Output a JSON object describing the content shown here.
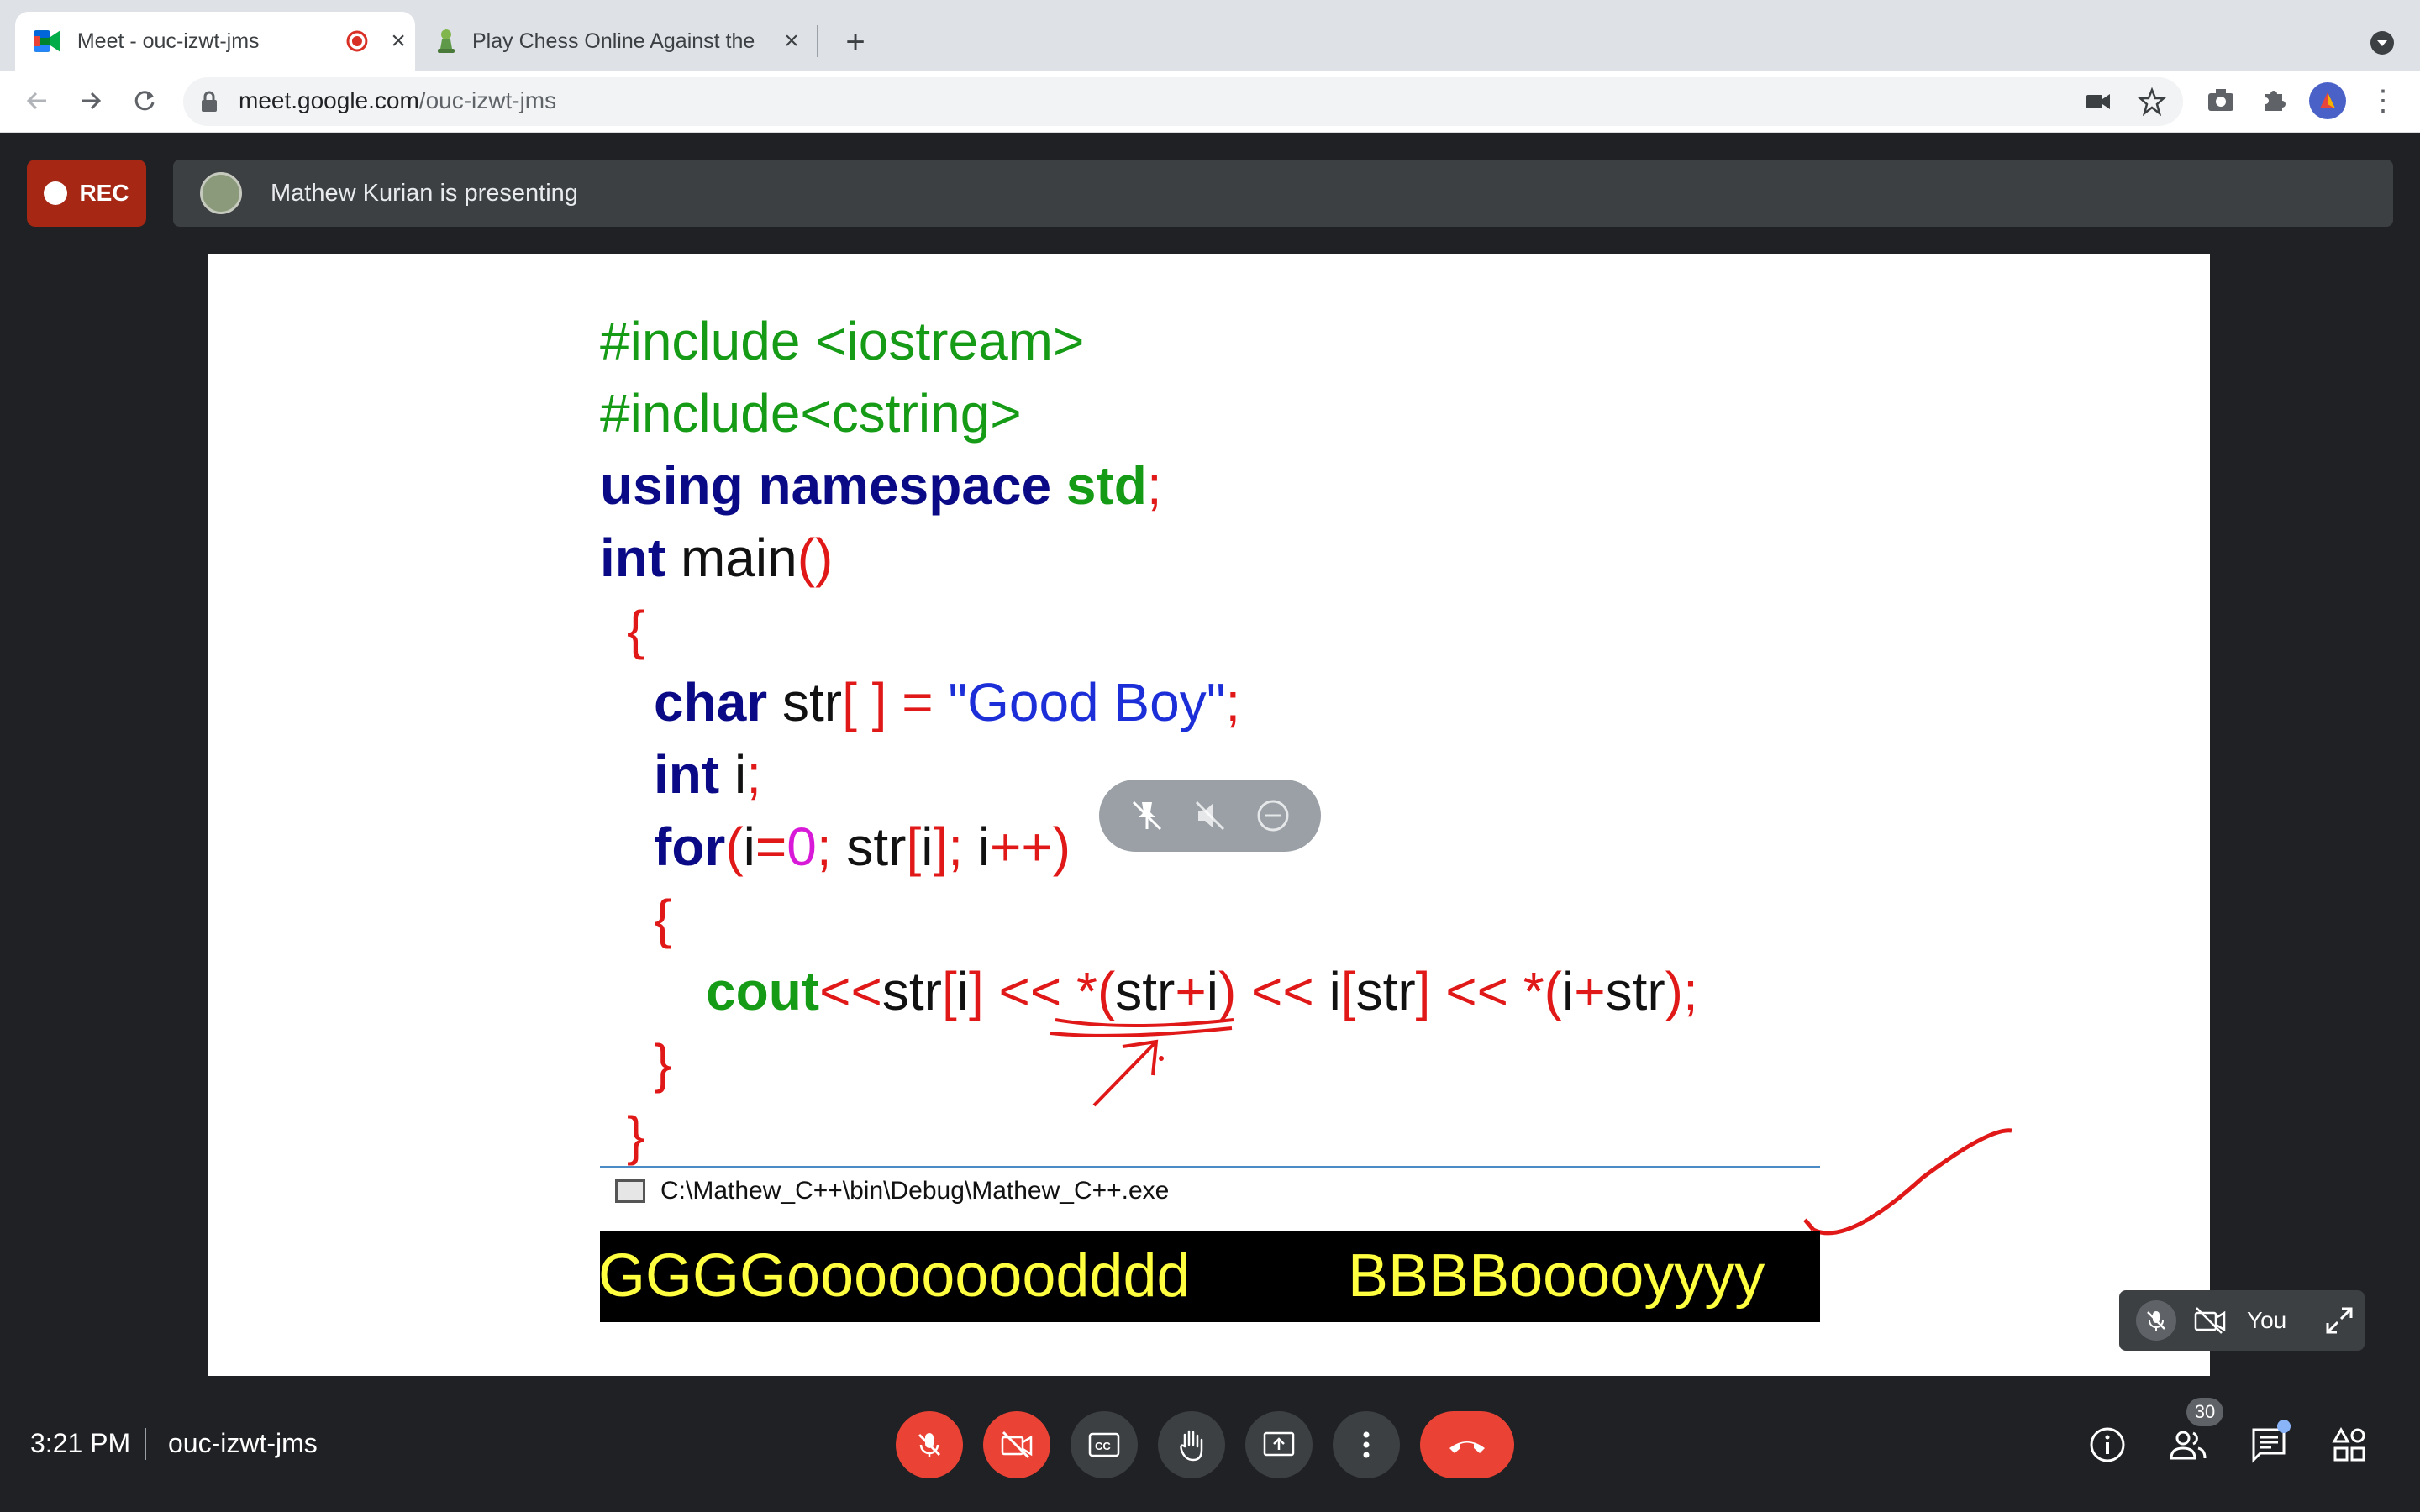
{
  "browser": {
    "tabs": [
      {
        "title": "Meet - ouc-izwt-jms",
        "active": true,
        "recording": true
      },
      {
        "title": "Play Chess Online Against the C",
        "active": false
      }
    ],
    "url_domain": "meet.google.com",
    "url_path": "/ouc-izwt-jms"
  },
  "meet": {
    "rec_label": "REC",
    "presenter_text": "Mathew Kurian is presenting",
    "self_label": "You",
    "time": "3:21 PM",
    "meeting_code": "ouc-izwt-jms",
    "participant_count": "30"
  },
  "slide": {
    "code_lines": [
      "#include <iostream>",
      "#include<cstring>",
      "using namespace std;",
      "int main()",
      "{",
      "char str[ ] = \"Good Boy\";",
      "int i;",
      "for(i=0; str[i]; i++)",
      "{",
      "cout<<str[i] << *(str+i) << i[str] << *(i+str);",
      "}",
      "}"
    ],
    "console_title": "C:\\Mathew_C++\\bin\\Debug\\Mathew_C++.exe",
    "console_output_1": "GGGGoooooooodddd",
    "console_output_2": "BBBBooooyyyy"
  },
  "colors": {
    "meet_bg": "#202124",
    "rec_red": "#a52714",
    "end_call_red": "#ea4335",
    "code_green": "#169b16",
    "code_navy": "#0a0a87",
    "code_red": "#e01818",
    "code_blue": "#1c2ed8",
    "console_yellow": "#ffff40"
  }
}
